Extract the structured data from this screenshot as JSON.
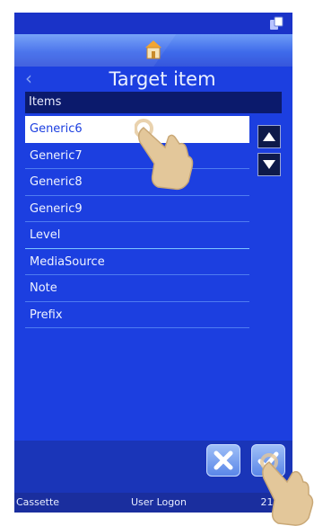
{
  "title": "Target item",
  "list_header": "Items",
  "items": [
    {
      "label": "Generic6"
    },
    {
      "label": "Generic7"
    },
    {
      "label": "Generic8"
    },
    {
      "label": "Generic9"
    },
    {
      "label": "Level"
    },
    {
      "label": "MediaSource"
    },
    {
      "label": "Note"
    },
    {
      "label": "Prefix"
    }
  ],
  "selected_item": "Generic6",
  "footer": {
    "left": "Cassette",
    "middle": "User Logon",
    "right": "21 11"
  },
  "colors": {
    "background": "#1c3fe0",
    "header_dark": "#0b1a6c",
    "selected_row": "#ffffff",
    "hand": "#e3c79a"
  },
  "icons": [
    "status-icon",
    "home-icon",
    "back-chevron-icon",
    "scroll-up-icon",
    "scroll-down-icon",
    "cancel-icon",
    "confirm-icon",
    "pointing-hand-icon"
  ]
}
